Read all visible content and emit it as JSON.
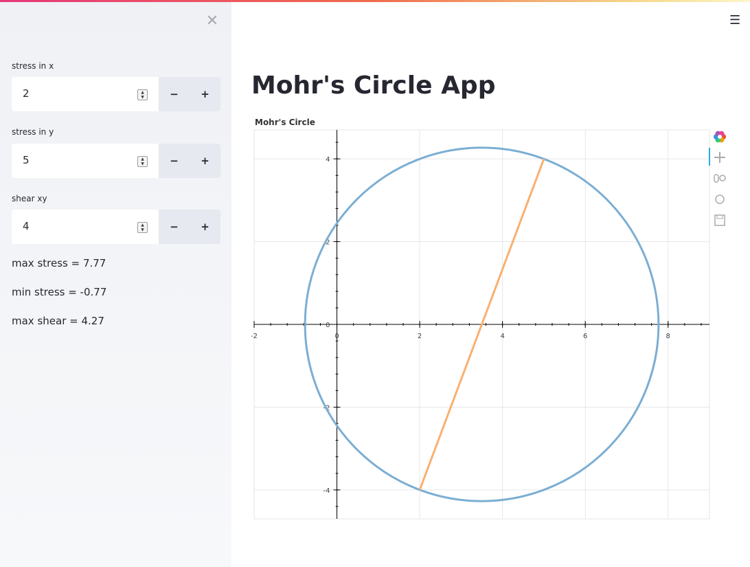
{
  "sidebar": {
    "close_icon": "close-icon",
    "inputs": [
      {
        "label": "stress in x",
        "value": "2",
        "minus": "−",
        "plus": "+"
      },
      {
        "label": "stress in y",
        "value": "5",
        "minus": "−",
        "plus": "+"
      },
      {
        "label": "shear xy",
        "value": "4",
        "minus": "−",
        "plus": "+"
      }
    ],
    "results": {
      "max_stress": "max stress = 7.77",
      "min_stress": "min stress = -0.77",
      "max_shear": "max shear = 4.27"
    }
  },
  "header": {
    "menu_icon": "hamburger-menu-icon"
  },
  "main": {
    "title": "Mohr's Circle App"
  },
  "toolbar": {
    "tools": [
      "bokeh-logo-icon",
      "pan-icon",
      "wheel-zoom-icon",
      "reset-icon",
      "save-icon"
    ]
  },
  "colors": {
    "circle": "#7baed3",
    "line": "#f9b06f",
    "accent_gradient_start": "#e6387a",
    "sidebar_bg": "#f0f2f6"
  },
  "chart_data": {
    "type": "line",
    "title": "Mohr's Circle",
    "xlabel": "",
    "ylabel": "",
    "xlim": [
      -2,
      9
    ],
    "ylim": [
      -4.7,
      4.7
    ],
    "x_ticks": [
      -2,
      0,
      2,
      4,
      6,
      8
    ],
    "y_ticks": [
      -4,
      -2,
      0,
      2,
      4
    ],
    "grid": true,
    "series": [
      {
        "kind": "circle",
        "center": [
          3.5,
          0
        ],
        "radius": 4.27,
        "color": "#7baed3"
      },
      {
        "kind": "segment",
        "x": [
          2,
          5
        ],
        "y": [
          -4,
          4
        ],
        "color": "#f9b06f"
      }
    ]
  }
}
